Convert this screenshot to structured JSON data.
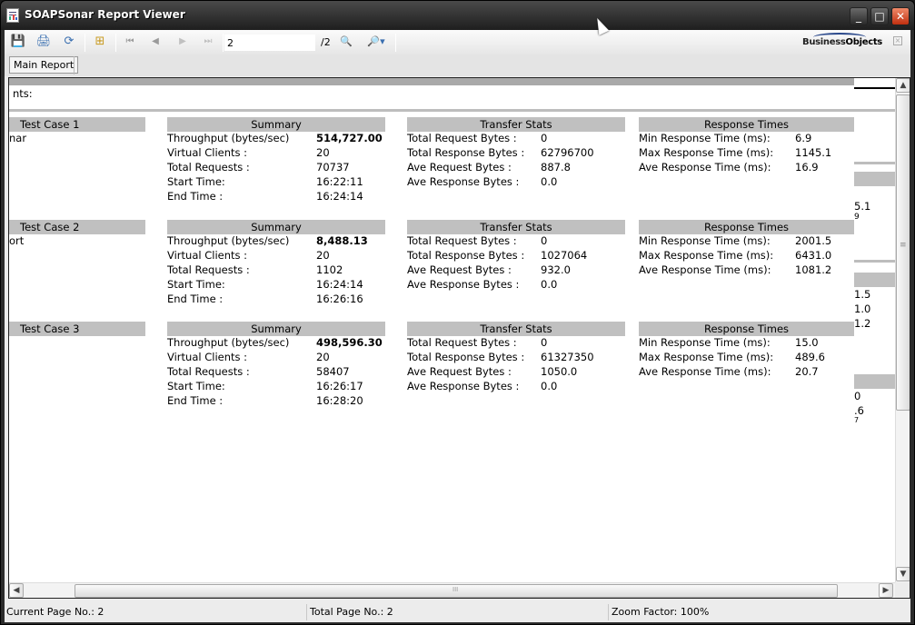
{
  "window": {
    "title": "SOAPSonar Report Viewer",
    "controls": {
      "minimize": "_",
      "maximize": "□",
      "close": "✕"
    }
  },
  "toolbar": {
    "buttons": [
      {
        "name": "export-icon",
        "glyph": "💾"
      },
      {
        "name": "print-icon",
        "glyph": "🖨"
      },
      {
        "name": "refresh-icon",
        "glyph": "⟳"
      },
      {
        "name": "group-tree-icon",
        "glyph": "⊞"
      },
      {
        "name": "first-page-icon",
        "glyph": "⏮"
      },
      {
        "name": "prev-page-icon",
        "glyph": "◀"
      },
      {
        "name": "next-page-icon",
        "glyph": "▶"
      },
      {
        "name": "last-page-icon",
        "glyph": "⏭"
      }
    ],
    "page_input_value": "2",
    "page_total": "/2",
    "search_glyph": "🔍",
    "zoom_glyph": "🔎▾",
    "logo_part1": "Business",
    "logo_part2": "Objects",
    "close_glyph": "×"
  },
  "tabs": [
    {
      "label": "Main Report"
    }
  ],
  "report": {
    "pre_text": "nts:",
    "test_cases": [
      {
        "header": "Test Case 1",
        "left_text": "nar",
        "summary": {
          "title": "Summary",
          "rows": [
            {
              "label": "Throughput  (bytes/sec)",
              "value": "514,727.00",
              "bold": true
            },
            {
              "label": "Virtual Clients :",
              "value": "20"
            },
            {
              "label": "Total Requests :",
              "value": "70737"
            },
            {
              "label": "Start Time:",
              "value": "16:22:11"
            },
            {
              "label": "End Time :",
              "value": "16:24:14"
            }
          ]
        },
        "transfer": {
          "title": "Transfer Stats",
          "rows": [
            {
              "label": "Total Request Bytes :",
              "value": "0"
            },
            {
              "label": "Total Response Bytes :",
              "value": "62796700"
            },
            {
              "label": "Ave Request Bytes :",
              "value": "887.8"
            },
            {
              "label": "Ave Response Bytes :",
              "value": "0.0"
            }
          ]
        },
        "response": {
          "title": "Response Times",
          "rows": [
            {
              "label": "Min Response Time  (ms):",
              "value": "6.9"
            },
            {
              "label": "Max Response Time  (ms):",
              "value": "1145.1"
            },
            {
              "label": "Ave Response Time  (ms):",
              "value": "16.9"
            }
          ]
        }
      },
      {
        "header": "Test Case 2",
        "left_text": "ort",
        "summary": {
          "title": "Summary",
          "rows": [
            {
              "label": "Throughput  (bytes/sec)",
              "value": "8,488.13",
              "bold": true
            },
            {
              "label": "Virtual Clients :",
              "value": "20"
            },
            {
              "label": "Total Requests :",
              "value": "1102"
            },
            {
              "label": "Start Time:",
              "value": "16:24:14"
            },
            {
              "label": "End Time :",
              "value": "16:26:16"
            }
          ]
        },
        "transfer": {
          "title": "Transfer Stats",
          "rows": [
            {
              "label": "Total Request Bytes :",
              "value": "0"
            },
            {
              "label": "Total Response Bytes :",
              "value": "1027064"
            },
            {
              "label": "Ave Request Bytes :",
              "value": "932.0"
            },
            {
              "label": "Ave Response Bytes :",
              "value": "0.0"
            }
          ]
        },
        "response": {
          "title": "Response Times",
          "rows": [
            {
              "label": "Min Response Time  (ms):",
              "value": "2001.5"
            },
            {
              "label": "Max Response Time  (ms):",
              "value": "6431.0"
            },
            {
              "label": "Ave Response Time  (ms):",
              "value": "1081.2"
            }
          ]
        }
      },
      {
        "header": "Test Case 3",
        "left_text": "",
        "summary": {
          "title": "Summary",
          "rows": [
            {
              "label": "Throughput  (bytes/sec)",
              "value": "498,596.30",
              "bold": true
            },
            {
              "label": "Virtual Clients :",
              "value": "20"
            },
            {
              "label": "Total Requests :",
              "value": "58407"
            },
            {
              "label": "Start Time:",
              "value": "16:26:17"
            },
            {
              "label": "End Time :",
              "value": "16:28:20"
            }
          ]
        },
        "transfer": {
          "title": "Transfer Stats",
          "rows": [
            {
              "label": "Total Request Bytes :",
              "value": "0"
            },
            {
              "label": "Total Response Bytes :",
              "value": "61327350"
            },
            {
              "label": "Ave Request Bytes :",
              "value": "1050.0"
            },
            {
              "label": "Ave Response Bytes :",
              "value": "0.0"
            }
          ]
        },
        "response": {
          "title": "Response Times",
          "rows": [
            {
              "label": "Min Response Time  (ms):",
              "value": "15.0"
            },
            {
              "label": "Max Response Time  (ms):",
              "value": "489.6"
            },
            {
              "label": "Ave Response Time  (ms):",
              "value": "20.7"
            }
          ]
        }
      }
    ],
    "cut_off_right_fragments": [
      "5.1",
      "9",
      "1.5",
      "1.0",
      "1.2",
      "0",
      ".6",
      "7"
    ]
  },
  "statusbar": {
    "current_page": "Current Page No.: 2",
    "total_page": "Total Page No.: 2",
    "zoom_factor": "Zoom Factor: 100%"
  }
}
